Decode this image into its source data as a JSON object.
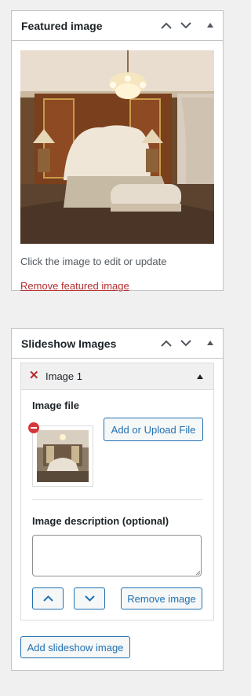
{
  "featured": {
    "title": "Featured image",
    "hint": "Click the image to edit or update",
    "remove_link": "Remove featured image"
  },
  "slideshow": {
    "title": "Slideshow Images",
    "item": {
      "title": "Image 1",
      "image_file_label": "Image file",
      "upload_button": "Add or Upload File",
      "description_label": "Image description (optional)",
      "description_value": "",
      "remove_button": "Remove image"
    },
    "add_button": "Add slideshow image"
  },
  "icons": {
    "move_up": "chevron-up-icon",
    "move_down": "chevron-down-icon",
    "toggle": "triangle-up-icon",
    "delete": "close-icon",
    "remove_thumbnail": "minus-circle-icon"
  },
  "colors": {
    "accent": "#2271b1",
    "danger": "#b32d2e",
    "border": "#c3c4c7",
    "background": "#f0f0f1"
  }
}
